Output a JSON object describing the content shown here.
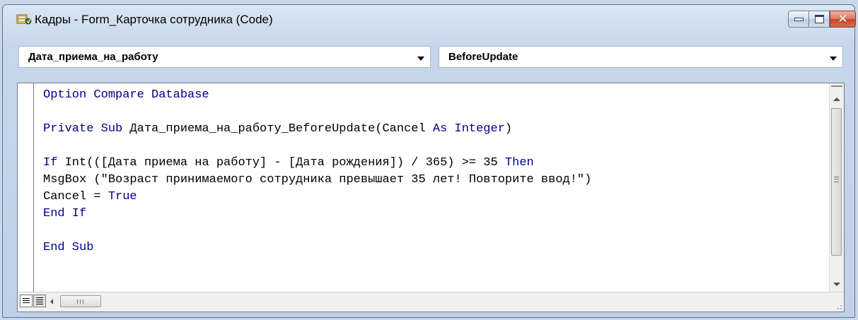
{
  "window": {
    "title": "Кадры - Form_Карточка сотрудника (Code)"
  },
  "toolbar": {
    "object_combo": "Дата_приема_на_работу",
    "procedure_combo": "BeforeUpdate"
  },
  "code_lines": [
    [
      {
        "t": "Option Compare Database",
        "kw": true
      }
    ],
    [],
    [
      {
        "t": "Private Sub",
        "kw": true
      },
      {
        "t": " Дата_приема_на_работу_BeforeUpdate(Cancel ",
        "kw": false
      },
      {
        "t": "As Integer",
        "kw": true
      },
      {
        "t": ")",
        "kw": false
      }
    ],
    [],
    [
      {
        "t": "If",
        "kw": true
      },
      {
        "t": " Int(([Дата приема на работу] - [Дата рождения]) / 365) >= 35 ",
        "kw": false
      },
      {
        "t": "Then",
        "kw": true
      }
    ],
    [
      {
        "t": "MsgBox (\"Возраст принимаемого сотрудника превышает 35 лет! Повторите ввод!\")",
        "kw": false
      }
    ],
    [
      {
        "t": "Cancel = ",
        "kw": false
      },
      {
        "t": "True",
        "kw": true
      }
    ],
    [
      {
        "t": "End If",
        "kw": true
      }
    ],
    [],
    [
      {
        "t": "End Sub",
        "kw": true
      }
    ]
  ],
  "colors": {
    "keyword": "#00008b",
    "text": "#000000",
    "close_button": "#c4452a"
  },
  "icons": {
    "app": "access-form-icon",
    "minimize": "minimize-icon",
    "maximize": "maximize-icon",
    "close": "close-icon"
  }
}
